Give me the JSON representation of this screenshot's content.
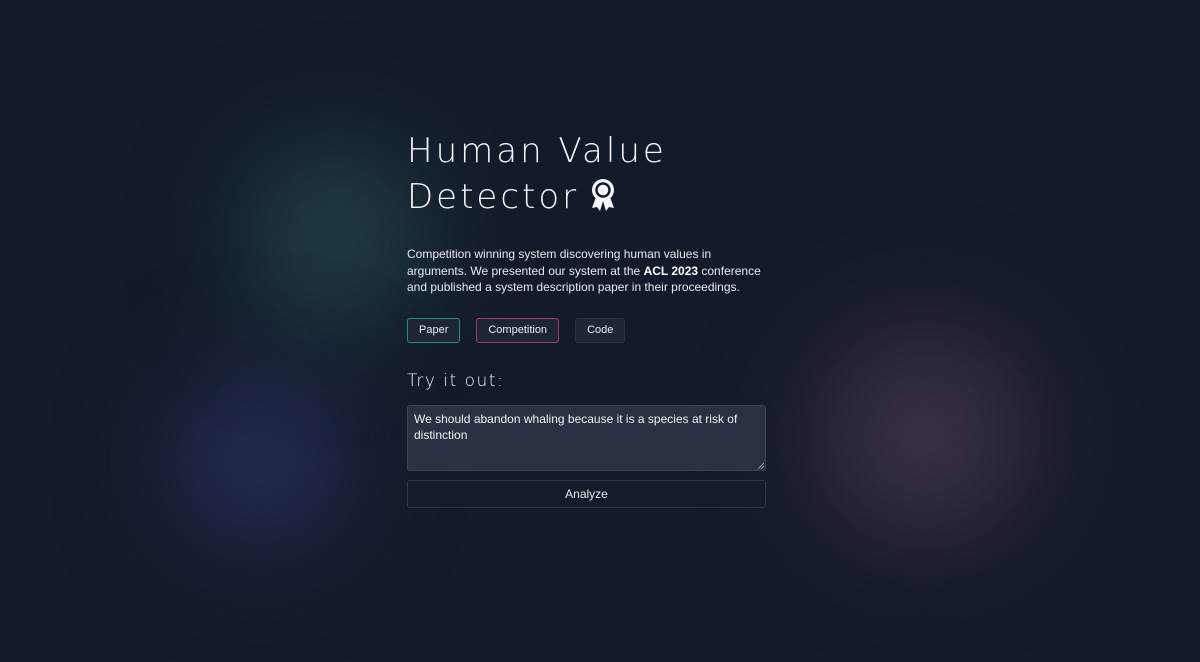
{
  "header": {
    "title_line1": "Human Value",
    "title_line2": "Detector",
    "title_icon": "award-ribbon-icon"
  },
  "description": {
    "part1": "Competition winning system discovering human values in arguments. We presented our system at the ",
    "highlight": "ACL 2023",
    "part2": " conference and published a system description paper in their proceedings."
  },
  "links": {
    "paper_label": "Paper",
    "competition_label": "Competition",
    "code_label": "Code"
  },
  "tryout": {
    "heading": "Try it out:",
    "input_value": "We should abandon whaling because it is a species at risk of distinction",
    "analyze_label": "Analyze"
  },
  "colors": {
    "background": "#131a29",
    "paper_border": "#2d8a7a",
    "competition_border": "#9a3a6e",
    "blob_green": "#37786e",
    "blob_blue": "#3c468c",
    "blob_pink": "#6e4b6e"
  }
}
